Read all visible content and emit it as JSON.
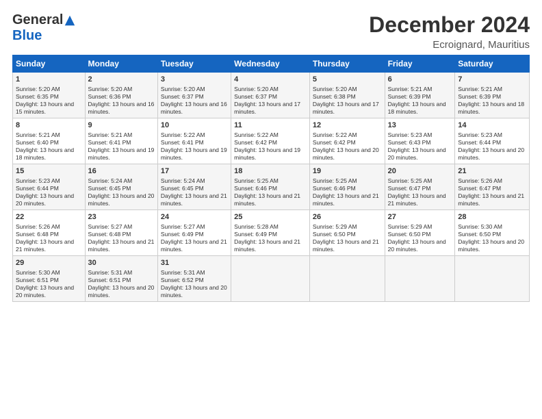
{
  "logo": {
    "general": "General",
    "blue": "Blue"
  },
  "title": "December 2024",
  "subtitle": "Ecroignard, Mauritius",
  "days_of_week": [
    "Sunday",
    "Monday",
    "Tuesday",
    "Wednesday",
    "Thursday",
    "Friday",
    "Saturday"
  ],
  "weeks": [
    [
      {
        "day": "1",
        "sunrise": "Sunrise: 5:20 AM",
        "sunset": "Sunset: 6:35 PM",
        "daylight": "Daylight: 13 hours and 15 minutes."
      },
      {
        "day": "2",
        "sunrise": "Sunrise: 5:20 AM",
        "sunset": "Sunset: 6:36 PM",
        "daylight": "Daylight: 13 hours and 16 minutes."
      },
      {
        "day": "3",
        "sunrise": "Sunrise: 5:20 AM",
        "sunset": "Sunset: 6:37 PM",
        "daylight": "Daylight: 13 hours and 16 minutes."
      },
      {
        "day": "4",
        "sunrise": "Sunrise: 5:20 AM",
        "sunset": "Sunset: 6:37 PM",
        "daylight": "Daylight: 13 hours and 17 minutes."
      },
      {
        "day": "5",
        "sunrise": "Sunrise: 5:20 AM",
        "sunset": "Sunset: 6:38 PM",
        "daylight": "Daylight: 13 hours and 17 minutes."
      },
      {
        "day": "6",
        "sunrise": "Sunrise: 5:21 AM",
        "sunset": "Sunset: 6:39 PM",
        "daylight": "Daylight: 13 hours and 18 minutes."
      },
      {
        "day": "7",
        "sunrise": "Sunrise: 5:21 AM",
        "sunset": "Sunset: 6:39 PM",
        "daylight": "Daylight: 13 hours and 18 minutes."
      }
    ],
    [
      {
        "day": "8",
        "sunrise": "Sunrise: 5:21 AM",
        "sunset": "Sunset: 6:40 PM",
        "daylight": "Daylight: 13 hours and 18 minutes."
      },
      {
        "day": "9",
        "sunrise": "Sunrise: 5:21 AM",
        "sunset": "Sunset: 6:41 PM",
        "daylight": "Daylight: 13 hours and 19 minutes."
      },
      {
        "day": "10",
        "sunrise": "Sunrise: 5:22 AM",
        "sunset": "Sunset: 6:41 PM",
        "daylight": "Daylight: 13 hours and 19 minutes."
      },
      {
        "day": "11",
        "sunrise": "Sunrise: 5:22 AM",
        "sunset": "Sunset: 6:42 PM",
        "daylight": "Daylight: 13 hours and 19 minutes."
      },
      {
        "day": "12",
        "sunrise": "Sunrise: 5:22 AM",
        "sunset": "Sunset: 6:42 PM",
        "daylight": "Daylight: 13 hours and 20 minutes."
      },
      {
        "day": "13",
        "sunrise": "Sunrise: 5:23 AM",
        "sunset": "Sunset: 6:43 PM",
        "daylight": "Daylight: 13 hours and 20 minutes."
      },
      {
        "day": "14",
        "sunrise": "Sunrise: 5:23 AM",
        "sunset": "Sunset: 6:44 PM",
        "daylight": "Daylight: 13 hours and 20 minutes."
      }
    ],
    [
      {
        "day": "15",
        "sunrise": "Sunrise: 5:23 AM",
        "sunset": "Sunset: 6:44 PM",
        "daylight": "Daylight: 13 hours and 20 minutes."
      },
      {
        "day": "16",
        "sunrise": "Sunrise: 5:24 AM",
        "sunset": "Sunset: 6:45 PM",
        "daylight": "Daylight: 13 hours and 20 minutes."
      },
      {
        "day": "17",
        "sunrise": "Sunrise: 5:24 AM",
        "sunset": "Sunset: 6:45 PM",
        "daylight": "Daylight: 13 hours and 21 minutes."
      },
      {
        "day": "18",
        "sunrise": "Sunrise: 5:25 AM",
        "sunset": "Sunset: 6:46 PM",
        "daylight": "Daylight: 13 hours and 21 minutes."
      },
      {
        "day": "19",
        "sunrise": "Sunrise: 5:25 AM",
        "sunset": "Sunset: 6:46 PM",
        "daylight": "Daylight: 13 hours and 21 minutes."
      },
      {
        "day": "20",
        "sunrise": "Sunrise: 5:25 AM",
        "sunset": "Sunset: 6:47 PM",
        "daylight": "Daylight: 13 hours and 21 minutes."
      },
      {
        "day": "21",
        "sunrise": "Sunrise: 5:26 AM",
        "sunset": "Sunset: 6:47 PM",
        "daylight": "Daylight: 13 hours and 21 minutes."
      }
    ],
    [
      {
        "day": "22",
        "sunrise": "Sunrise: 5:26 AM",
        "sunset": "Sunset: 6:48 PM",
        "daylight": "Daylight: 13 hours and 21 minutes."
      },
      {
        "day": "23",
        "sunrise": "Sunrise: 5:27 AM",
        "sunset": "Sunset: 6:48 PM",
        "daylight": "Daylight: 13 hours and 21 minutes."
      },
      {
        "day": "24",
        "sunrise": "Sunrise: 5:27 AM",
        "sunset": "Sunset: 6:49 PM",
        "daylight": "Daylight: 13 hours and 21 minutes."
      },
      {
        "day": "25",
        "sunrise": "Sunrise: 5:28 AM",
        "sunset": "Sunset: 6:49 PM",
        "daylight": "Daylight: 13 hours and 21 minutes."
      },
      {
        "day": "26",
        "sunrise": "Sunrise: 5:29 AM",
        "sunset": "Sunset: 6:50 PM",
        "daylight": "Daylight: 13 hours and 21 minutes."
      },
      {
        "day": "27",
        "sunrise": "Sunrise: 5:29 AM",
        "sunset": "Sunset: 6:50 PM",
        "daylight": "Daylight: 13 hours and 20 minutes."
      },
      {
        "day": "28",
        "sunrise": "Sunrise: 5:30 AM",
        "sunset": "Sunset: 6:50 PM",
        "daylight": "Daylight: 13 hours and 20 minutes."
      }
    ],
    [
      {
        "day": "29",
        "sunrise": "Sunrise: 5:30 AM",
        "sunset": "Sunset: 6:51 PM",
        "daylight": "Daylight: 13 hours and 20 minutes."
      },
      {
        "day": "30",
        "sunrise": "Sunrise: 5:31 AM",
        "sunset": "Sunset: 6:51 PM",
        "daylight": "Daylight: 13 hours and 20 minutes."
      },
      {
        "day": "31",
        "sunrise": "Sunrise: 5:31 AM",
        "sunset": "Sunset: 6:52 PM",
        "daylight": "Daylight: 13 hours and 20 minutes."
      },
      null,
      null,
      null,
      null
    ]
  ]
}
